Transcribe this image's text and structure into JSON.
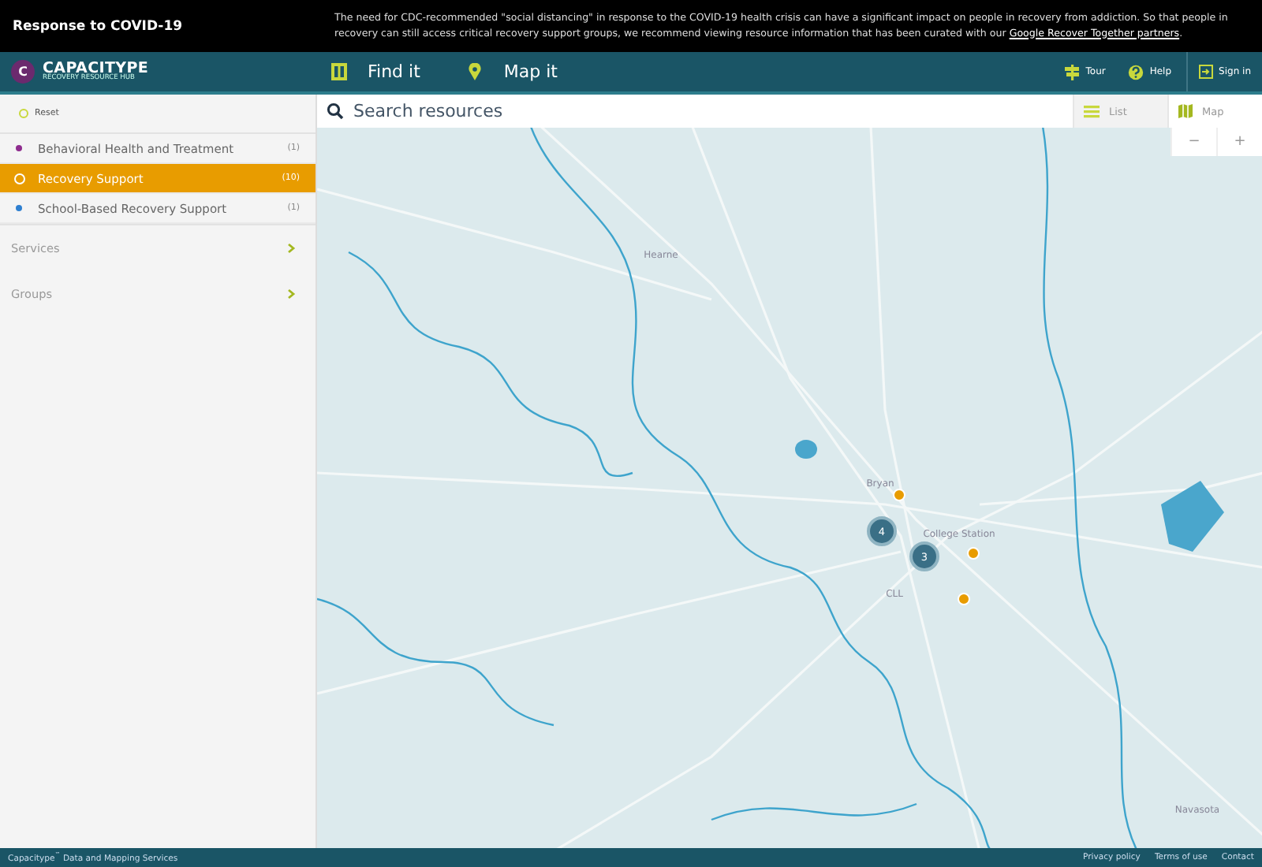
{
  "banner": {
    "title": "Response to COVID-19",
    "message": "The need for CDC-recommended \"social distancing\" in response to the COVID-19 health crisis can have a significant impact on people in recovery from addiction. So that people in recovery can still access critical recovery support groups, we recommend viewing resource information that has been curated with our",
    "link": "Google Recover Together partners",
    "end": "."
  },
  "header": {
    "logo_letter": "C",
    "brand": "CAPACITYPE",
    "tagline": "RECOVERY RESOURCE HUB",
    "nav": [
      {
        "label": "Find it",
        "kind": "book"
      },
      {
        "label": "Map it",
        "kind": "pin"
      }
    ],
    "actions": [
      {
        "label": "Tour",
        "kind": "sign"
      },
      {
        "label": "Help",
        "kind": "help"
      },
      {
        "label": "Sign in",
        "kind": "signin"
      }
    ]
  },
  "sidebar": {
    "reset": "Reset",
    "categories": [
      {
        "label": "Behavioral Health and Treatment",
        "count": "(1)",
        "color": "#8e2c8e",
        "selected": false
      },
      {
        "label": "Recovery Support",
        "count": "(10)",
        "color": "#e89c00",
        "selected": true
      },
      {
        "label": "School-Based Recovery Support",
        "count": "(1)",
        "color": "#2e7fd0",
        "selected": false
      }
    ],
    "sections": [
      {
        "label": "Services",
        "expanded": false
      },
      {
        "label": "Groups",
        "expanded": false
      }
    ]
  },
  "search": {
    "placeholder": "Search resources"
  },
  "view_toggle": [
    {
      "label": "List",
      "kind": "list",
      "selected": false
    },
    {
      "label": "Map",
      "kind": "map",
      "selected": true
    }
  ],
  "zoom": {
    "out": "−",
    "in": "+"
  },
  "map": {
    "places": [
      "Hearne",
      "Bryan",
      "College Station",
      "CLL",
      "Navasota"
    ],
    "markers": [
      {
        "kind": "cluster",
        "label": "4"
      },
      {
        "kind": "cluster",
        "label": "3"
      },
      {
        "kind": "dot"
      },
      {
        "kind": "dot"
      },
      {
        "kind": "dot"
      }
    ]
  },
  "footer": {
    "brand": "Capacitype",
    "mark": "™",
    "tagline": "Data and Mapping Services",
    "links": [
      "Privacy policy",
      "Terms of use",
      "Contact"
    ]
  }
}
